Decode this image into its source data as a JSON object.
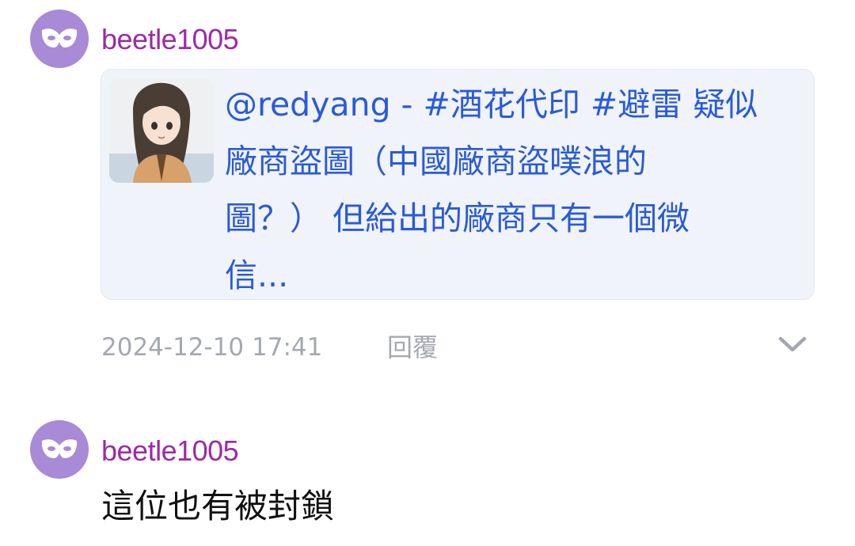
{
  "comments": [
    {
      "username": "beetle1005",
      "avatar_icon": "mask-icon",
      "quote": {
        "lines": [
          "@redyang - #酒花代印 #避雷 疑似",
          "廠商盜圖（中國廠商盜噗浪的",
          "圖？） 但給出的廠商只有一個微",
          "信..."
        ]
      },
      "timestamp": "2024-12-10 17:41",
      "reply_label": "回覆",
      "expand_icon": "chevron-down-icon"
    },
    {
      "username": "beetle1005",
      "avatar_icon": "mask-icon",
      "text": "這位也有被封鎖"
    }
  ],
  "colors": {
    "username": "#9c2aa5",
    "link": "#2a5bd6",
    "meta": "#a4a8b0",
    "avatar_bg": "#a98ad6",
    "quote_bg": "#f1f3fb"
  }
}
